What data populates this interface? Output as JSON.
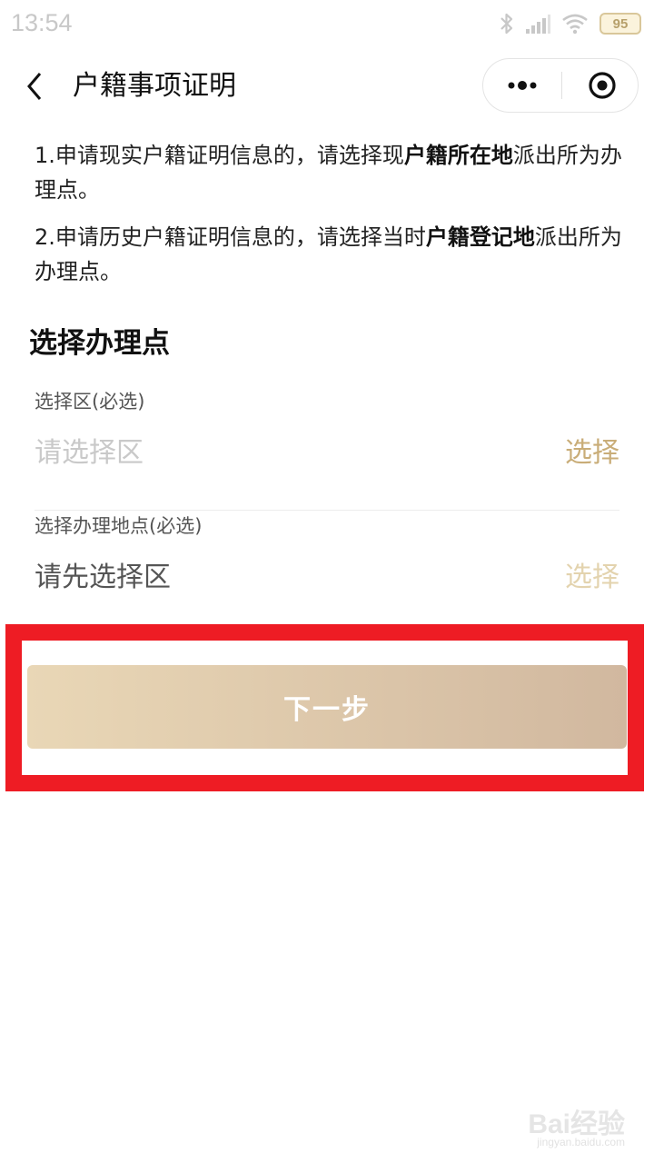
{
  "status_bar": {
    "time": "13:54",
    "battery": "95"
  },
  "nav": {
    "title": "户籍事项证明"
  },
  "notes": [
    {
      "pre": "1.申请现实户籍证明信息的，请选择现",
      "bold": "户籍所在地",
      "post": "派出所为办理点。"
    },
    {
      "pre": "2.申请历史户籍证明信息的，请选择当时",
      "bold": "户籍登记地",
      "post": "派出所为办理点。"
    }
  ],
  "section_title": "选择办理点",
  "fields": [
    {
      "label": "选择区(必选)",
      "value": "请选择区",
      "action": "选择"
    },
    {
      "label": "选择办理地点(必选)",
      "value": "请先选择区",
      "action": "选择"
    }
  ],
  "next_button": "下一步",
  "watermark": {
    "logo": "Bai经验",
    "url": "jingyan.baidu.com"
  },
  "colors": {
    "accent": "#c9ad78",
    "button_start": "#e9d7b6",
    "button_end": "#d1b89f",
    "highlight": "#ee1c24"
  }
}
